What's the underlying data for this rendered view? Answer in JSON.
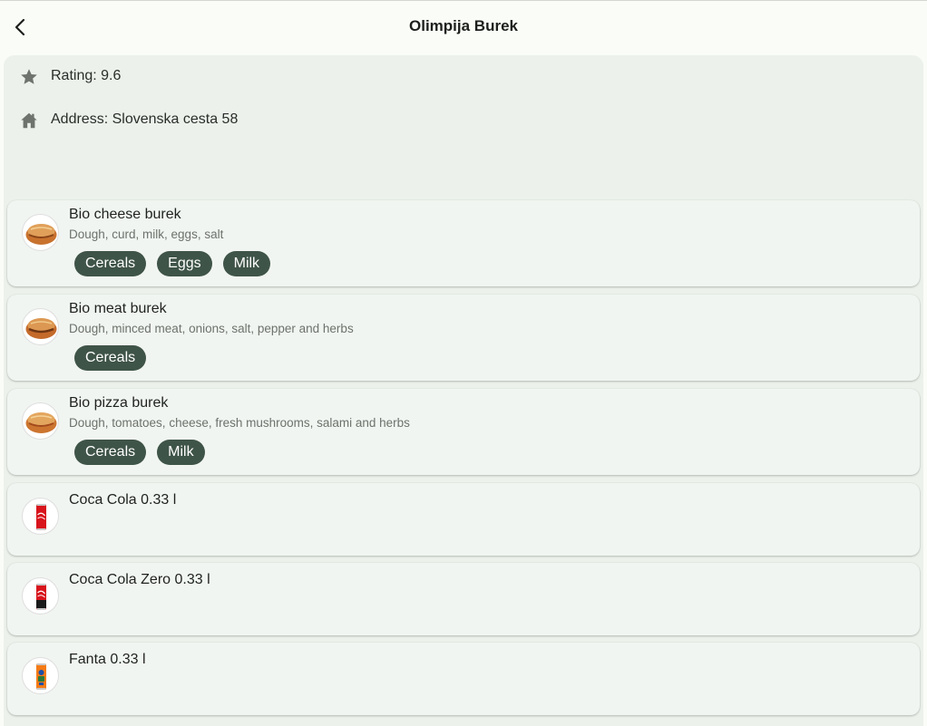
{
  "header": {
    "title": "Olimpija Burek",
    "back_icon": "arrow-back-icon"
  },
  "info": {
    "rating": "Rating: 9.6",
    "rating_icon": "star-icon",
    "address": "Address: Slovenska cesta 58",
    "address_icon": "home-icon"
  },
  "menu": {
    "items": [
      {
        "name": "Bio cheese burek",
        "description": "Dough, curd, milk, eggs, salt",
        "allergens": [
          "Cereals",
          "Eggs",
          "Milk"
        ],
        "image": "burek-image"
      },
      {
        "name": "Bio meat burek",
        "description": "Dough, minced meat, onions, salt, pepper and herbs",
        "allergens": [
          "Cereals"
        ],
        "image": "burek-image"
      },
      {
        "name": "Bio pizza burek",
        "description": "Dough, tomatoes, cheese, fresh mushrooms, salami and herbs",
        "allergens": [
          "Cereals",
          "Milk"
        ],
        "image": "burek-image"
      },
      {
        "name": "Coca Cola 0.33 l",
        "image": "coca-cola-can-image"
      },
      {
        "name": "Coca Cola Zero 0.33 l",
        "image": "coca-cola-zero-can-image"
      },
      {
        "name": "Fanta 0.33 l",
        "image": "fanta-can-image"
      }
    ]
  },
  "colors": {
    "tag_background": "#3f5448",
    "panel_background": "#ecf1eb",
    "card_background": "#f1f5f1",
    "icon_gray": "#6e736e"
  }
}
